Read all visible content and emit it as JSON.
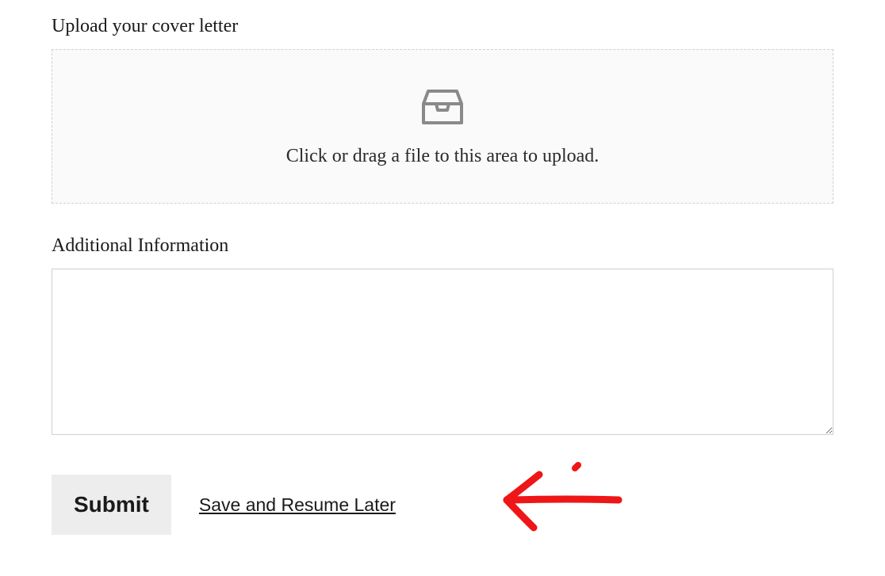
{
  "upload": {
    "label": "Upload your cover letter",
    "instruction": "Click or drag a file to this area to upload."
  },
  "additional": {
    "label": "Additional Information",
    "value": ""
  },
  "actions": {
    "submit_label": "Submit",
    "save_resume_label": "Save and Resume Later"
  }
}
